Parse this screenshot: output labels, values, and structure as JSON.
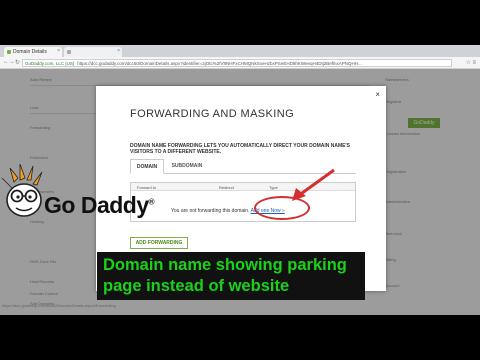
{
  "browser": {
    "tabs": [
      {
        "label": "Domain Details",
        "active": true
      },
      {
        "label": "",
        "active": false
      }
    ],
    "secure_label": "GoDaddy.com, LLC [US]",
    "url": "https://dcc.godaddy.com/dcc50/DomainDetails.aspx?identifier=2jOtc%2fV8NHFxCHMQNkSxeHzbxPSeEHD8hKWeeqH4Dtj2BeflnxAPNQHH..."
  },
  "background_page": {
    "left_column": [
      "Auto Renew",
      "Lock",
      "Forwarding",
      "Protection",
      "Nameservers",
      "Hosting",
      "DNS Zone File",
      "Host Records",
      "Domain Control",
      "Sub Domains"
    ],
    "right_column": [
      "Nameservers",
      "Registrar",
      "Contact Information",
      "Registration",
      "Administrative",
      "Technical",
      "Billing",
      "Account"
    ],
    "badge": "GoDaddy"
  },
  "modal": {
    "title": "FORWARDING AND MASKING",
    "description": "DOMAIN NAME FORWARDING LETS YOU AUTOMATICALLY DIRECT YOUR DOMAIN NAME'S VISITORS TO A DIFFERENT WEBSITE.",
    "tabs": [
      {
        "label": "DOMAIN",
        "active": true
      },
      {
        "label": "SUBDOMAIN",
        "active": false
      }
    ],
    "table": {
      "headers": [
        "Forward to",
        "Redirect",
        "Type"
      ],
      "empty_message": "You are not forwarding this domain.",
      "add_link": "Add one Now »"
    },
    "add_button": "ADD FORWARDING",
    "close": "×"
  },
  "logo": {
    "text": "Go Daddy",
    "mark": "®"
  },
  "caption": {
    "text": "Domain name showing parking page instead of website"
  },
  "statusbar": "https://dcc.godaddy.com/dcc50/DomainDetails.aspx#Forwarding",
  "colors": {
    "caption_text": "#19d219",
    "accent_green": "#7bb343",
    "annotation_red": "#d32f2f"
  }
}
